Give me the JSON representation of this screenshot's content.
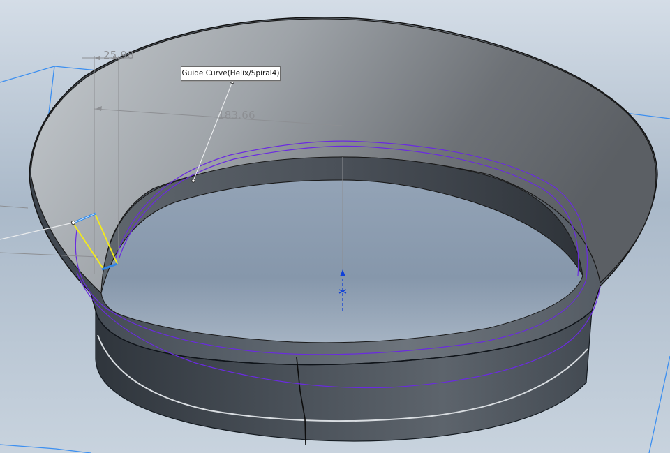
{
  "viewport": {
    "name": "3D model viewport"
  },
  "callout": {
    "label": "Guide Curve(Helix/Spiral4)"
  },
  "dimensions": {
    "horizontal": "25.98",
    "diameter": "183.66"
  },
  "colors": {
    "background_top": "#d2dbe5",
    "background_bottom": "#c7d3df",
    "sketch_plane": "#3c8ff0",
    "helix_curve": "#6a2be0",
    "profile_yellow": "#f2ea1c",
    "profile_blue": "#2f86e8",
    "origin_axis": "#1040d8"
  },
  "icons": {
    "origin": "origin-arrow-icon"
  }
}
